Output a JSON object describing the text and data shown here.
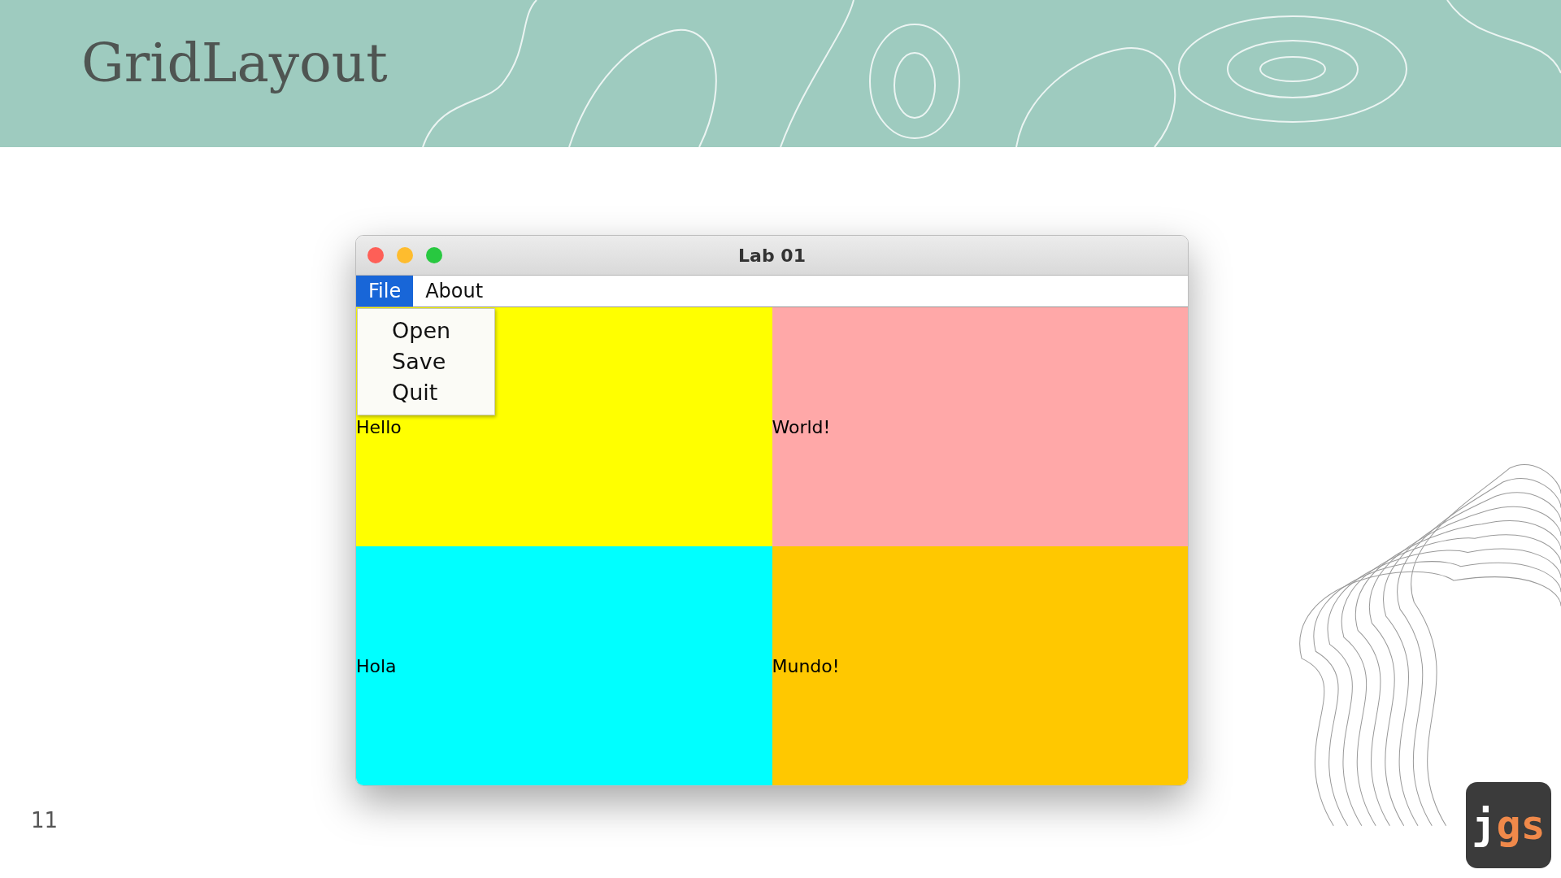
{
  "slide": {
    "title": "GridLayout",
    "page_number": "11"
  },
  "window": {
    "title": "Lab 01",
    "menus": [
      {
        "label": "File",
        "selected": true
      },
      {
        "label": "About",
        "selected": false
      }
    ],
    "dropdown": {
      "items": [
        "Open",
        "Save",
        "Quit"
      ]
    },
    "cells": [
      {
        "label": "Hello",
        "color": "#ffff00"
      },
      {
        "label": "World!",
        "color": "#ffa8a8"
      },
      {
        "label": "Hola",
        "color": "#00ffff"
      },
      {
        "label": "Mundo!",
        "color": "#ffc800"
      }
    ]
  },
  "logo": {
    "parts": [
      {
        "text": "j",
        "color": "#ffffff"
      },
      {
        "text": "gs",
        "color": "#f0894a"
      }
    ]
  }
}
